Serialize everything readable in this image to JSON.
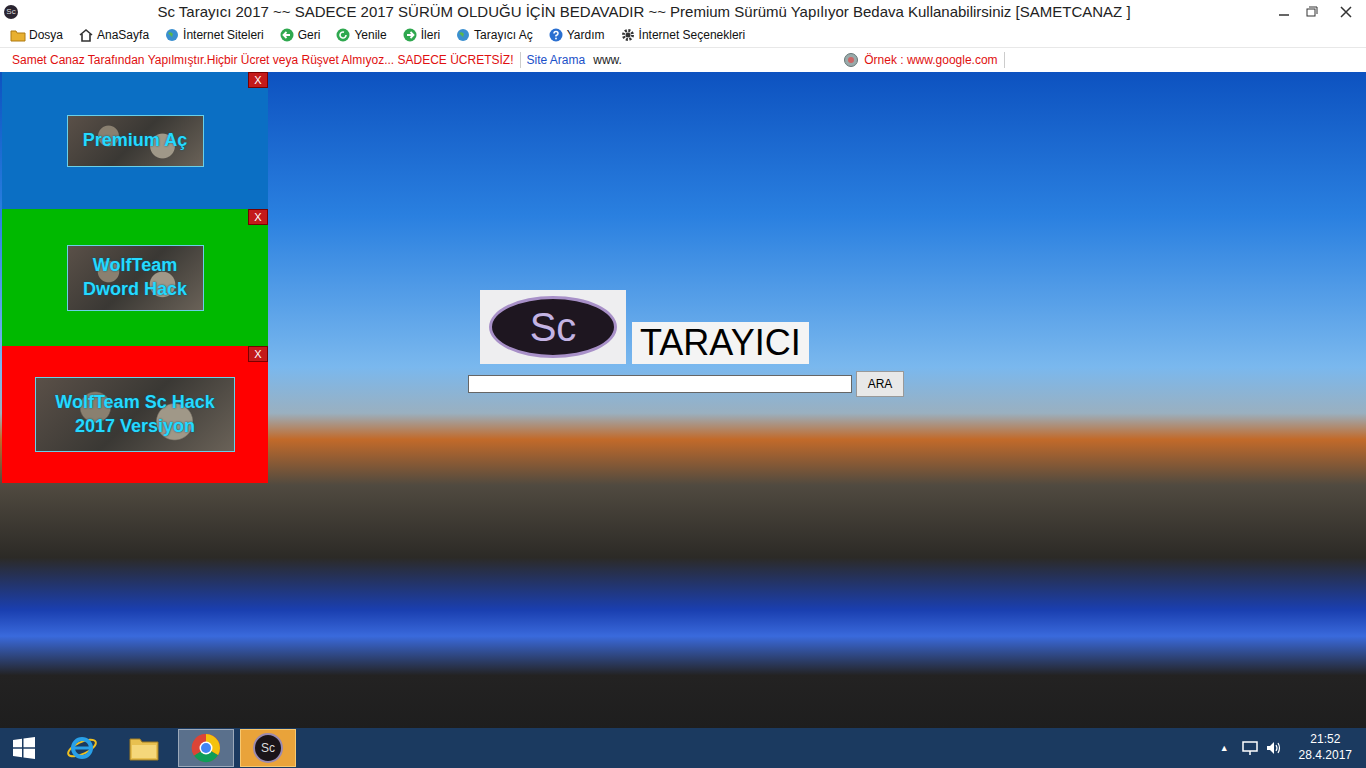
{
  "window": {
    "title": "Sc Tarayıcı 2017 ~~ SADECE 2017 SÜRÜM OLDUĞU İÇİN BEDAVADIR ~~ Premium Sürümü Yapılıyor Bedava Kullanabilirsiniz [SAMETCANAZ ]",
    "icon_text": "Sc"
  },
  "toolbar": [
    {
      "label": "Dosya",
      "kind": "folder"
    },
    {
      "label": "AnaSayfa",
      "kind": "home"
    },
    {
      "label": "İnternet Siteleri",
      "kind": "globe"
    },
    {
      "label": "Geri",
      "kind": "back"
    },
    {
      "label": "Yenile",
      "kind": "refresh"
    },
    {
      "label": "İleri",
      "kind": "forward"
    },
    {
      "label": "Tarayıcı Aç",
      "kind": "globe"
    },
    {
      "label": "Yardım",
      "kind": "help"
    },
    {
      "label": "İnternet Seçenekleri",
      "kind": "gear"
    }
  ],
  "info_bar": {
    "notice": "Samet Canaz Tarafından Yapılmıştır.Hiçbir Ücret veya Rüşvet Almıyoz... SADECE ÜCRETSİZ!",
    "search_label": "Site Arama",
    "address": "www.",
    "example": "Örnek : www.google.com"
  },
  "side_panels": [
    {
      "label": "Premium Aç",
      "close": "X",
      "color": "#0b6fc4"
    },
    {
      "label": "WolfTeam Dword Hack",
      "close": "X",
      "color": "#00b900"
    },
    {
      "label": "WolfTeam Sc Hack 2017 Versiyon",
      "close": "X",
      "color": "#ff0000"
    }
  ],
  "logo": {
    "mark": "Sc",
    "name": "TARAYICI"
  },
  "search": {
    "value": "",
    "button": "ARA"
  },
  "taskbar": {
    "apps": [
      {
        "kind": "ie",
        "running": false,
        "selected": false
      },
      {
        "kind": "explorer",
        "running": false,
        "selected": false
      },
      {
        "kind": "chrome",
        "running": true,
        "selected": false
      },
      {
        "kind": "sc",
        "running": true,
        "selected": true,
        "label": "Sc"
      }
    ],
    "tray_arrow": "▲",
    "time": "21:52",
    "date": "28.4.2017"
  }
}
